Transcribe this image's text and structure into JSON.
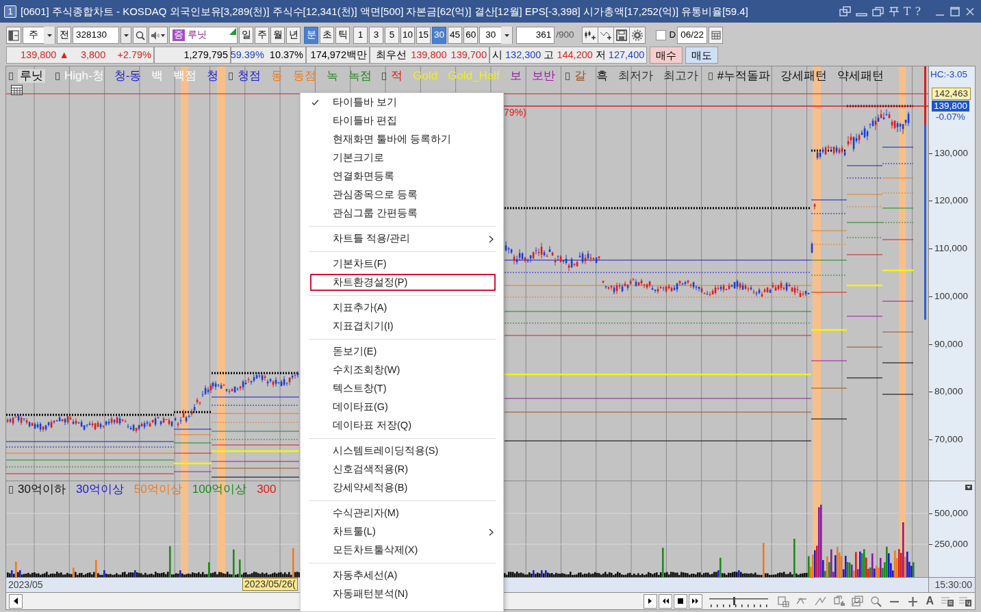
{
  "window": {
    "number": "1",
    "title": "[0601] 주식종합차트 - KOSDAQ 외국인보유[3,289(천)] 주식수[12,341(천)] 액면[500] 자본금[62(억)] 결산[12월] EPS[-3,398] 시가총액[17,252(억)] 유통비율[59.4]",
    "tool_letters": [
      "T",
      "?"
    ]
  },
  "toolbar": {
    "market": "주",
    "all_button": "전",
    "code": "328130",
    "badge": "증",
    "stock_name": "루닛",
    "periods": [
      {
        "label": "일",
        "selected": false
      },
      {
        "label": "주",
        "selected": false
      },
      {
        "label": "월",
        "selected": false
      },
      {
        "label": "년",
        "selected": false
      },
      {
        "label": "분",
        "selected": true
      },
      {
        "label": "초",
        "selected": false
      },
      {
        "label": "틱",
        "selected": false
      }
    ],
    "intervals": [
      {
        "label": "1",
        "selected": false
      },
      {
        "label": "3",
        "selected": false
      },
      {
        "label": "5",
        "selected": false
      },
      {
        "label": "10",
        "selected": false
      },
      {
        "label": "15",
        "selected": false
      },
      {
        "label": "30",
        "selected": true
      },
      {
        "label": "45",
        "selected": false
      },
      {
        "label": "60",
        "selected": false
      }
    ],
    "interval_select": "30",
    "count": "361",
    "max_count": "/900",
    "date_toggle": {
      "checked": false,
      "label": "D"
    },
    "date": "06/22"
  },
  "quote": {
    "groups": [
      [
        {
          "text": "139,800 ▲",
          "color": "#e0201c"
        },
        {
          "text": "3,800",
          "color": "#e0201c"
        },
        {
          "text": "+2.79%",
          "color": "#e0201c"
        }
      ],
      [
        {
          "text": "1,279,795",
          "color": "#000000"
        }
      ],
      [
        {
          "text": "59.39%",
          "color": "#1c3fd0"
        },
        {
          "text": "10.37%",
          "color": "#000000"
        }
      ],
      [
        {
          "text": "174,972백만",
          "color": "#000000"
        }
      ],
      [
        {
          "text": "최우선",
          "color": "#000000"
        },
        {
          "text": "139,800",
          "color": "#e0201c"
        },
        {
          "text": "139,700",
          "color": "#e0201c"
        }
      ],
      [
        {
          "text": "시",
          "color": "#000000"
        },
        {
          "text": "132,300",
          "color": "#1c3fd0"
        },
        {
          "text": "고",
          "color": "#000000"
        },
        {
          "text": "144,200",
          "color": "#e0201c"
        },
        {
          "text": "저",
          "color": "#000000"
        },
        {
          "text": "127,400",
          "color": "#1c3fd0"
        }
      ]
    ],
    "trade_buttons": [
      {
        "label": "매수",
        "kind": "buy"
      },
      {
        "label": "매도",
        "kind": "sell"
      }
    ]
  },
  "price_pane": {
    "legend": [
      {
        "label": "루닛",
        "color": "#000000",
        "marker": true,
        "selected": true
      },
      {
        "label": "High-청",
        "color": "#ffffff",
        "marker": true,
        "selected": false
      },
      {
        "label": "청-동",
        "color": "#1b1bd0",
        "marker": false,
        "selected": false
      },
      {
        "label": "백",
        "color": "#ffffff",
        "marker": false,
        "selected": false
      },
      {
        "label": "백점",
        "color": "#ffffff",
        "marker": false,
        "selected": false
      },
      {
        "label": "청",
        "color": "#1b1bd0",
        "marker": false,
        "selected": false
      },
      {
        "label": "청점",
        "color": "#1b1bd0",
        "marker": true,
        "selected": false
      },
      {
        "label": "동",
        "color": "#f07a1a",
        "marker": false,
        "selected": false
      },
      {
        "label": "동점",
        "color": "#f07a1a",
        "marker": false,
        "selected": false
      },
      {
        "label": "녹",
        "color": "#1a8a1a",
        "marker": false,
        "selected": false
      },
      {
        "label": "녹점",
        "color": "#1a8a1a",
        "marker": false,
        "selected": false
      },
      {
        "label": "적",
        "color": "#e01a1a",
        "marker": true,
        "selected": false
      },
      {
        "label": "Gold",
        "color": "#eeee22",
        "marker": false,
        "selected": false
      },
      {
        "label": "Gold_Half",
        "color": "#eeee22",
        "marker": false,
        "selected": false
      },
      {
        "label": "보",
        "color": "#9a1aa0",
        "marker": false,
        "selected": false
      },
      {
        "label": "보반",
        "color": "#9a1aa0",
        "marker": false,
        "selected": false
      },
      {
        "label": "갈",
        "color": "#a0521a",
        "marker": true,
        "selected": false
      },
      {
        "label": "흑",
        "color": "#111111",
        "marker": false,
        "selected": false
      },
      {
        "label": "최저가",
        "color": "#333333",
        "marker": false,
        "selected": false
      },
      {
        "label": "최고가",
        "color": "#333333",
        "marker": false,
        "selected": false
      },
      {
        "label": "#누적돌파",
        "color": "#111111",
        "marker": true,
        "selected": false
      },
      {
        "label": "강세패턴",
        "color": "#111111",
        "marker": false,
        "selected": false
      },
      {
        "label": "약세패턴",
        "color": "#111111",
        "marker": false,
        "selected": false
      }
    ],
    "annotation": "79%)",
    "axis_ticks": [
      "130,000",
      "120,000",
      "110,000",
      "100,000",
      "90,000",
      "80,000",
      "70,000"
    ],
    "hc_reading": "HC:-3.05",
    "high_tag": "142,463",
    "price_tag": "139,800",
    "change_tag": "-0.07%"
  },
  "volume_pane": {
    "legend": [
      {
        "label": "30억이하",
        "color": "#111111",
        "marker": true
      },
      {
        "label": "30억이상",
        "color": "#1b1bd0",
        "marker": false
      },
      {
        "label": "50억이상",
        "color": "#f07a1a",
        "marker": false
      },
      {
        "label": "100억이상",
        "color": "#1a8a1a",
        "marker": false
      },
      {
        "label": "300",
        "color": "#e01a1a",
        "marker": false
      }
    ],
    "axis_ticks": [
      "500,000",
      "250,000"
    ]
  },
  "time_axis": {
    "start_label": "2023/05",
    "cursor_label": "2023/05/26(",
    "time": "15:30:00"
  },
  "bottom_toolbar": {
    "zoom_slider": {
      "level": 0.42
    },
    "font_button": "A"
  },
  "context_menu": {
    "sections": [
      [
        {
          "label": "타이틀바 보기",
          "checked": true,
          "submenu": false,
          "highlighted": false
        },
        {
          "label": "타이틀바 편집",
          "checked": false,
          "submenu": false,
          "highlighted": false
        },
        {
          "label": "현재화면 툴바에 등록하기",
          "checked": false,
          "submenu": false,
          "highlighted": false
        },
        {
          "label": "기본크기로",
          "checked": false,
          "submenu": false,
          "highlighted": false
        },
        {
          "label": "연결화면등록",
          "checked": false,
          "submenu": false,
          "highlighted": false
        },
        {
          "label": "관심종목으로 등록",
          "checked": false,
          "submenu": false,
          "highlighted": false
        },
        {
          "label": "관심그룹 간편등록",
          "checked": false,
          "submenu": false,
          "highlighted": false
        }
      ],
      [
        {
          "label": "차트틀 적용/관리",
          "checked": false,
          "submenu": true,
          "highlighted": false
        }
      ],
      [
        {
          "label": "기본차트(F)",
          "checked": false,
          "submenu": false,
          "highlighted": false
        },
        {
          "label": "차트환경설정(P)",
          "checked": false,
          "submenu": false,
          "highlighted": true
        }
      ],
      [
        {
          "label": "지표추가(A)",
          "checked": false,
          "submenu": false,
          "highlighted": false
        },
        {
          "label": "지표겹치기(I)",
          "checked": false,
          "submenu": false,
          "highlighted": false
        }
      ],
      [
        {
          "label": "돋보기(E)",
          "checked": false,
          "submenu": false,
          "highlighted": false
        },
        {
          "label": "수치조회창(W)",
          "checked": false,
          "submenu": false,
          "highlighted": false
        },
        {
          "label": "텍스트창(T)",
          "checked": false,
          "submenu": false,
          "highlighted": false
        },
        {
          "label": "데이타표(G)",
          "checked": false,
          "submenu": false,
          "highlighted": false
        },
        {
          "label": "데이타표 저장(Q)",
          "checked": false,
          "submenu": false,
          "highlighted": false
        }
      ],
      [
        {
          "label": "시스템트레이딩적용(S)",
          "checked": false,
          "submenu": false,
          "highlighted": false
        },
        {
          "label": "신호검색적용(R)",
          "checked": false,
          "submenu": false,
          "highlighted": false
        },
        {
          "label": "강세약세적용(B)",
          "checked": false,
          "submenu": false,
          "highlighted": false
        }
      ],
      [
        {
          "label": "수식관리자(M)",
          "checked": false,
          "submenu": false,
          "highlighted": false
        },
        {
          "label": "차트툴(L)",
          "checked": false,
          "submenu": true,
          "highlighted": false
        },
        {
          "label": "모든차트툴삭제(X)",
          "checked": false,
          "submenu": false,
          "highlighted": false
        }
      ],
      [
        {
          "label": "자동추세선(A)",
          "checked": false,
          "submenu": false,
          "highlighted": false
        },
        {
          "label": "자동패턴분석(N)",
          "checked": false,
          "submenu": false,
          "highlighted": false
        }
      ]
    ]
  }
}
